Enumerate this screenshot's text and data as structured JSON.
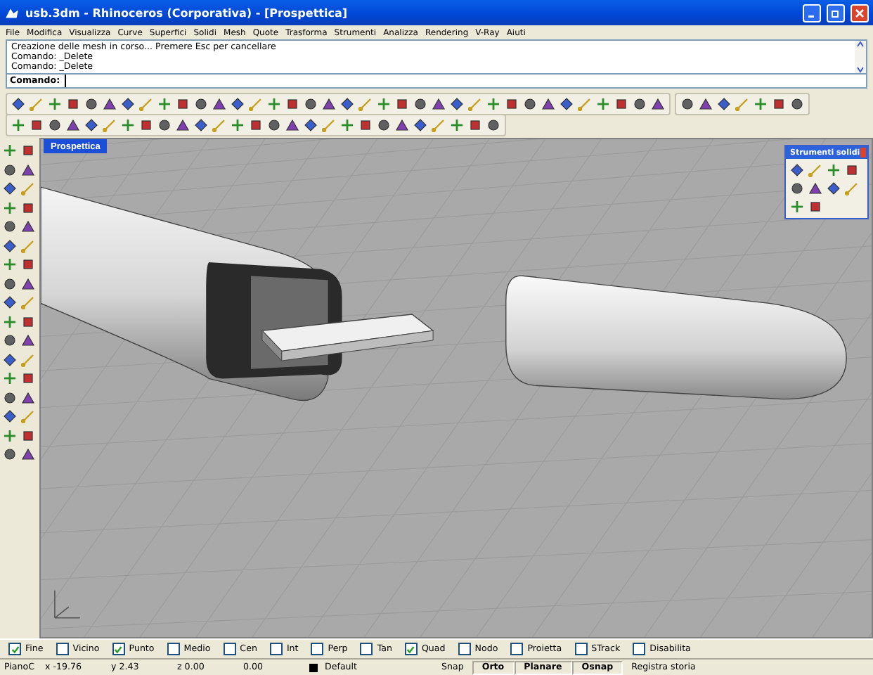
{
  "window": {
    "title": "usb.3dm - Rhinoceros (Corporativa) - [Prospettica]"
  },
  "menu": [
    "File",
    "Modifica",
    "Visualizza",
    "Curve",
    "Superfici",
    "Solidi",
    "Mesh",
    "Quote",
    "Trasforma",
    "Strumenti",
    "Analizza",
    "Rendering",
    "V-Ray",
    "Aiuti"
  ],
  "command_history": [
    "Creazione delle mesh in corso... Premere Esc per cancellare",
    "Comando: _Delete",
    "Comando: _Delete"
  ],
  "command_prompt": {
    "label": "Comando:"
  },
  "viewport": {
    "title": "Prospettica"
  },
  "floating_toolbar": {
    "title": "Strumenti solidi"
  },
  "osnaps": [
    {
      "label": "Fine",
      "checked": true
    },
    {
      "label": "Vicino",
      "checked": false
    },
    {
      "label": "Punto",
      "checked": true
    },
    {
      "label": "Medio",
      "checked": false
    },
    {
      "label": "Cen",
      "checked": false
    },
    {
      "label": "Int",
      "checked": false
    },
    {
      "label": "Perp",
      "checked": false
    },
    {
      "label": "Tan",
      "checked": false
    },
    {
      "label": "Quad",
      "checked": true
    },
    {
      "label": "Nodo",
      "checked": false
    },
    {
      "label": "Proietta",
      "checked": false
    },
    {
      "label": "STrack",
      "checked": false
    },
    {
      "label": "Disabilita",
      "checked": false
    }
  ],
  "status_bar": {
    "plane": "PianoC",
    "x": "x -19.76",
    "y": "y 2.43",
    "z": "z 0.00",
    "distance": "0.00",
    "layer": "Default",
    "toggles": [
      {
        "label": "Snap",
        "on": false
      },
      {
        "label": "Orto",
        "on": true
      },
      {
        "label": "Planare",
        "on": true
      },
      {
        "label": "Osnap",
        "on": true
      },
      {
        "label": "Registra storia",
        "on": false
      }
    ]
  }
}
